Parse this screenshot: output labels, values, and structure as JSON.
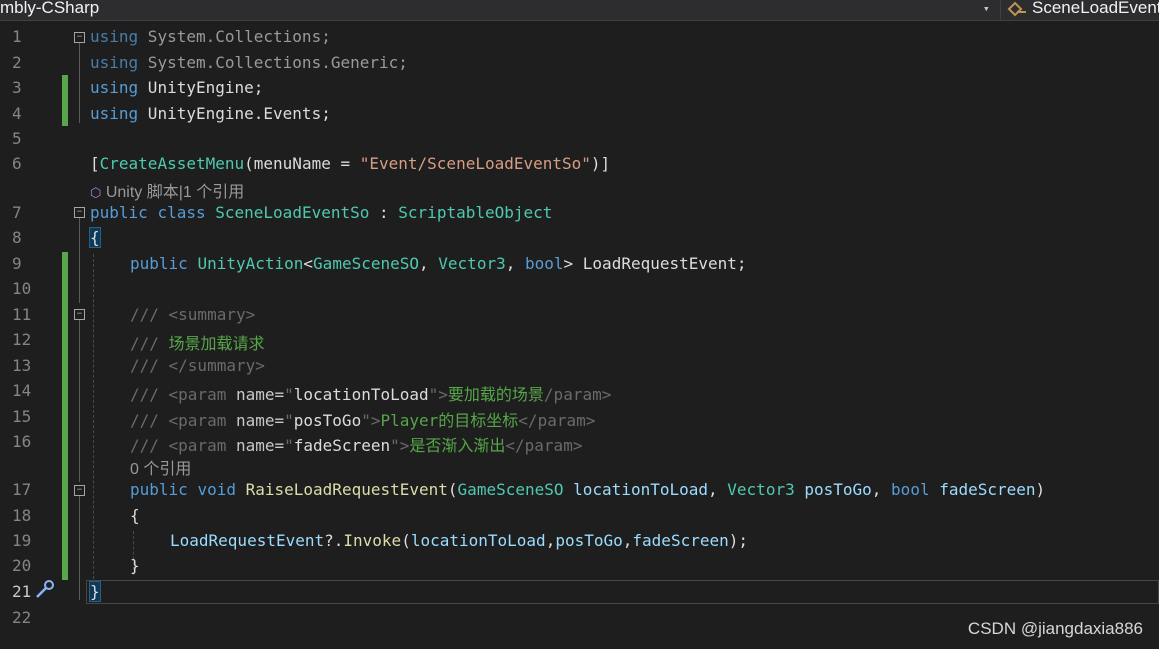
{
  "toolbar": {
    "project_label": "mbly-CSharp",
    "dropdown_arrow": "▾",
    "member_label": "SceneLoadEvent",
    "member_icon": "member-icon"
  },
  "editor": {
    "line_numbers": [
      "1",
      "2",
      "3",
      "4",
      "5",
      "6",
      "7",
      "8",
      "9",
      "10",
      "11",
      "12",
      "13",
      "14",
      "15",
      "16",
      "17",
      "18",
      "19",
      "20",
      "21",
      "22"
    ],
    "lines": {
      "l1": {
        "kw": "using",
        "rest": " System.Collections;"
      },
      "l2": {
        "kw": "using",
        "rest": " System.Collections.Generic;"
      },
      "l3": {
        "kw": "using",
        "rest": " UnityEngine;"
      },
      "l4": {
        "kw": "using",
        "rest": " UnityEngine.Events;"
      },
      "l6": {
        "open": "[",
        "attr": "CreateAssetMenu",
        "arg": "(menuName = ",
        "str": "\"Event/SceneLoadEventSo\"",
        "close": ")]"
      },
      "lens6": "Unity 脚本|1 个引用",
      "l7": {
        "kw1": "public",
        "kw2": "class",
        "name": "SceneLoadEventSo",
        "colon": " : ",
        "base": "ScriptableObject"
      },
      "l8": {
        "brace": "{"
      },
      "l9": {
        "kw": "public",
        "type": "UnityAction",
        "lt": "<",
        "t1": "GameSceneSO",
        "c1": ", ",
        "t2": "Vector3",
        "c2": ", ",
        "t3": "bool",
        "gt": ">",
        "name": " LoadRequestEvent;"
      },
      "l11": {
        "slashes": "/// ",
        "tag": "<summary>"
      },
      "l12": {
        "slashes": "/// ",
        "text": "场景加载请求"
      },
      "l13": {
        "slashes": "/// ",
        "tag": "</summary>"
      },
      "l14": {
        "slashes": "/// ",
        "open": "<param",
        "attr": " name=",
        "q1": "\"",
        "val": "locationToLoad",
        "q2": "\"",
        "close": ">",
        "text": "要加载的场景",
        "end": "/param>"
      },
      "l15": {
        "slashes": "/// ",
        "open": "<param",
        "attr": " name=",
        "q1": "\"",
        "val": "posToGo",
        "q2": "\"",
        "close": ">",
        "text": "Player的目标坐标",
        "end": "</param>"
      },
      "l16": {
        "slashes": "/// ",
        "open": "<param",
        "attr": " name=",
        "q1": "\"",
        "val": "fadeScreen",
        "q2": "\"",
        "close": ">",
        "text": "是否渐入渐出",
        "end": "</param>"
      },
      "lens17": "0 个引用",
      "l17": {
        "kw1": "public",
        "kw2": "void",
        "name": "RaiseLoadRequestEvent",
        "p": "(",
        "t1": "GameSceneSO",
        "a1": " locationToLoad",
        "c1": ", ",
        "t2": "Vector3",
        "a2": " posToGo",
        "c2": ", ",
        "t3": "bool",
        "a3": " fadeScreen",
        "pe": ")"
      },
      "l18": {
        "brace": "{"
      },
      "l19": {
        "obj": "LoadRequestEvent",
        "op": "?.",
        "mth": "Invoke",
        "p": "(",
        "a1": "locationToLoad",
        "c1": ",",
        "a2": "posToGo",
        "c2": ",",
        "a3": "fadeScreen",
        "pe": ");"
      },
      "l20": {
        "brace": "}"
      },
      "l21": {
        "brace": "}"
      }
    }
  },
  "watermark": "CSDN @jiangdaxia886",
  "colors": {
    "keyword": "#569cd6",
    "type": "#4ec9b0",
    "string": "#d69d85",
    "comment": "#57a64a",
    "change_bar": "#57a64a",
    "background": "#1e1e1e"
  }
}
